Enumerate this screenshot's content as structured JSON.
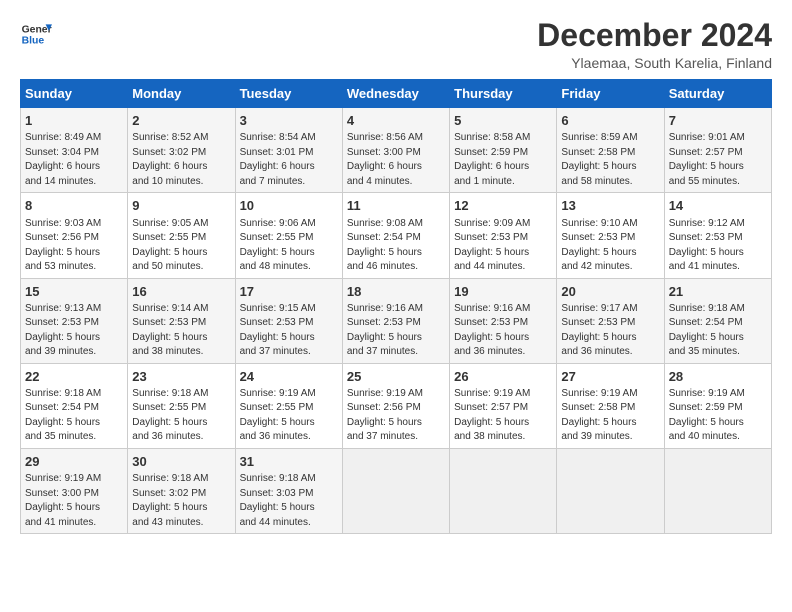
{
  "logo": {
    "line1": "General",
    "line2": "Blue"
  },
  "title": "December 2024",
  "subtitle": "Ylaemaa, South Karelia, Finland",
  "headers": [
    "Sunday",
    "Monday",
    "Tuesday",
    "Wednesday",
    "Thursday",
    "Friday",
    "Saturday"
  ],
  "weeks": [
    [
      {
        "day": "1",
        "info": "Sunrise: 8:49 AM\nSunset: 3:04 PM\nDaylight: 6 hours\nand 14 minutes."
      },
      {
        "day": "2",
        "info": "Sunrise: 8:52 AM\nSunset: 3:02 PM\nDaylight: 6 hours\nand 10 minutes."
      },
      {
        "day": "3",
        "info": "Sunrise: 8:54 AM\nSunset: 3:01 PM\nDaylight: 6 hours\nand 7 minutes."
      },
      {
        "day": "4",
        "info": "Sunrise: 8:56 AM\nSunset: 3:00 PM\nDaylight: 6 hours\nand 4 minutes."
      },
      {
        "day": "5",
        "info": "Sunrise: 8:58 AM\nSunset: 2:59 PM\nDaylight: 6 hours\nand 1 minute."
      },
      {
        "day": "6",
        "info": "Sunrise: 8:59 AM\nSunset: 2:58 PM\nDaylight: 5 hours\nand 58 minutes."
      },
      {
        "day": "7",
        "info": "Sunrise: 9:01 AM\nSunset: 2:57 PM\nDaylight: 5 hours\nand 55 minutes."
      }
    ],
    [
      {
        "day": "8",
        "info": "Sunrise: 9:03 AM\nSunset: 2:56 PM\nDaylight: 5 hours\nand 53 minutes."
      },
      {
        "day": "9",
        "info": "Sunrise: 9:05 AM\nSunset: 2:55 PM\nDaylight: 5 hours\nand 50 minutes."
      },
      {
        "day": "10",
        "info": "Sunrise: 9:06 AM\nSunset: 2:55 PM\nDaylight: 5 hours\nand 48 minutes."
      },
      {
        "day": "11",
        "info": "Sunrise: 9:08 AM\nSunset: 2:54 PM\nDaylight: 5 hours\nand 46 minutes."
      },
      {
        "day": "12",
        "info": "Sunrise: 9:09 AM\nSunset: 2:53 PM\nDaylight: 5 hours\nand 44 minutes."
      },
      {
        "day": "13",
        "info": "Sunrise: 9:10 AM\nSunset: 2:53 PM\nDaylight: 5 hours\nand 42 minutes."
      },
      {
        "day": "14",
        "info": "Sunrise: 9:12 AM\nSunset: 2:53 PM\nDaylight: 5 hours\nand 41 minutes."
      }
    ],
    [
      {
        "day": "15",
        "info": "Sunrise: 9:13 AM\nSunset: 2:53 PM\nDaylight: 5 hours\nand 39 minutes."
      },
      {
        "day": "16",
        "info": "Sunrise: 9:14 AM\nSunset: 2:53 PM\nDaylight: 5 hours\nand 38 minutes."
      },
      {
        "day": "17",
        "info": "Sunrise: 9:15 AM\nSunset: 2:53 PM\nDaylight: 5 hours\nand 37 minutes."
      },
      {
        "day": "18",
        "info": "Sunrise: 9:16 AM\nSunset: 2:53 PM\nDaylight: 5 hours\nand 37 minutes."
      },
      {
        "day": "19",
        "info": "Sunrise: 9:16 AM\nSunset: 2:53 PM\nDaylight: 5 hours\nand 36 minutes."
      },
      {
        "day": "20",
        "info": "Sunrise: 9:17 AM\nSunset: 2:53 PM\nDaylight: 5 hours\nand 36 minutes."
      },
      {
        "day": "21",
        "info": "Sunrise: 9:18 AM\nSunset: 2:54 PM\nDaylight: 5 hours\nand 35 minutes."
      }
    ],
    [
      {
        "day": "22",
        "info": "Sunrise: 9:18 AM\nSunset: 2:54 PM\nDaylight: 5 hours\nand 35 minutes."
      },
      {
        "day": "23",
        "info": "Sunrise: 9:18 AM\nSunset: 2:55 PM\nDaylight: 5 hours\nand 36 minutes."
      },
      {
        "day": "24",
        "info": "Sunrise: 9:19 AM\nSunset: 2:55 PM\nDaylight: 5 hours\nand 36 minutes."
      },
      {
        "day": "25",
        "info": "Sunrise: 9:19 AM\nSunset: 2:56 PM\nDaylight: 5 hours\nand 37 minutes."
      },
      {
        "day": "26",
        "info": "Sunrise: 9:19 AM\nSunset: 2:57 PM\nDaylight: 5 hours\nand 38 minutes."
      },
      {
        "day": "27",
        "info": "Sunrise: 9:19 AM\nSunset: 2:58 PM\nDaylight: 5 hours\nand 39 minutes."
      },
      {
        "day": "28",
        "info": "Sunrise: 9:19 AM\nSunset: 2:59 PM\nDaylight: 5 hours\nand 40 minutes."
      }
    ],
    [
      {
        "day": "29",
        "info": "Sunrise: 9:19 AM\nSunset: 3:00 PM\nDaylight: 5 hours\nand 41 minutes."
      },
      {
        "day": "30",
        "info": "Sunrise: 9:18 AM\nSunset: 3:02 PM\nDaylight: 5 hours\nand 43 minutes."
      },
      {
        "day": "31",
        "info": "Sunrise: 9:18 AM\nSunset: 3:03 PM\nDaylight: 5 hours\nand 44 minutes."
      },
      null,
      null,
      null,
      null
    ]
  ]
}
